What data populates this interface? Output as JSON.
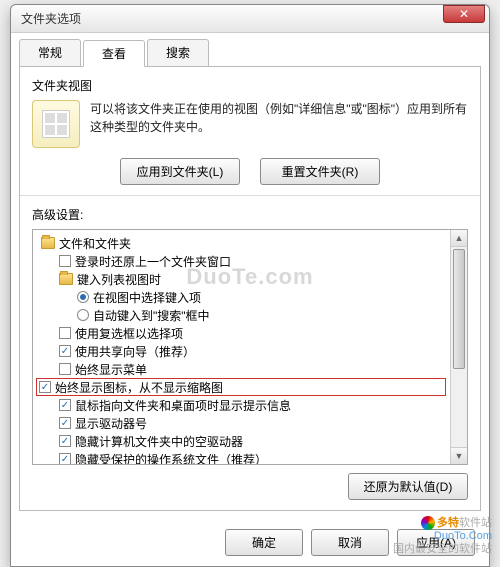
{
  "title": "文件夹选项",
  "close_glyph": "✕",
  "tabs": {
    "t0": "常规",
    "t1": "查看",
    "t2": "搜索"
  },
  "folder_view": {
    "label": "文件夹视图",
    "desc": "可以将该文件夹正在使用的视图（例如\"详细信息\"或\"图标\"）应用到所有这种类型的文件夹中。",
    "apply_btn": "应用到文件夹(L)",
    "reset_btn": "重置文件夹(R)"
  },
  "advanced": {
    "label": "高级设置:",
    "root": "文件和文件夹",
    "i1": "登录时还原上一个文件夹窗口",
    "i2": "键入列表视图时",
    "i2a": "在视图中选择键入项",
    "i2b": "自动键入到\"搜索\"框中",
    "i3": "使用复选框以选择项",
    "i4": "使用共享向导（推荐）",
    "i5": "始终显示菜单",
    "i6": "始终显示图标，从不显示缩略图",
    "i7": "鼠标指向文件夹和桌面项时显示提示信息",
    "i8": "显示驱动器号",
    "i9": "隐藏计算机文件夹中的空驱动器",
    "i10": "隐藏受保护的操作系统文件（推荐）",
    "restore_btn": "还原为默认值(D)"
  },
  "buttons": {
    "ok": "确定",
    "cancel": "取消",
    "apply": "应用(A)"
  },
  "watermark": {
    "mid": "DuoTe.com",
    "slogan": "国内最安全的软件站",
    "brand1": "多特",
    "brand2": "软件站",
    "url": "DuoTo.Com"
  }
}
